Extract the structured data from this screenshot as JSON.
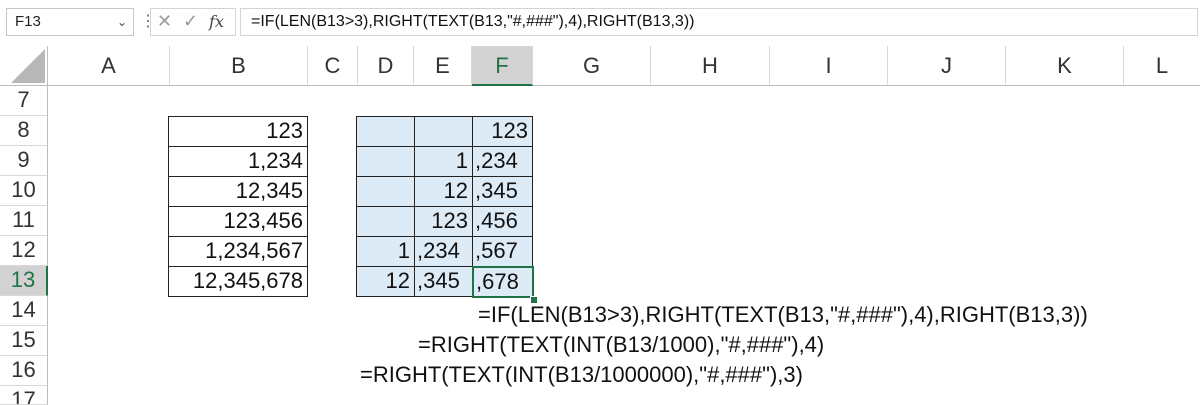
{
  "formula_bar": {
    "name_box": "F13",
    "cancel_glyph": "✕",
    "enter_glyph": "✓",
    "fx_label": "fx",
    "formula": "=IF(LEN(B13>3),RIGHT(TEXT(B13,\"#,###\"),4),RIGHT(B13,3))"
  },
  "columns": [
    "A",
    "B",
    "C",
    "D",
    "E",
    "F",
    "G",
    "H",
    "I",
    "J",
    "K",
    "L"
  ],
  "rows": [
    "7",
    "8",
    "9",
    "10",
    "11",
    "12",
    "13",
    "14",
    "15",
    "16",
    "17"
  ],
  "selected": {
    "cell": "F13",
    "column": "F",
    "row": "13"
  },
  "table_b": [
    "123",
    "1,234",
    "12,345",
    "123,456",
    "1,234,567",
    "12,345,678"
  ],
  "table_def": [
    [
      "",
      "",
      "123"
    ],
    [
      "",
      "1",
      ",234"
    ],
    [
      "",
      "12",
      ",345"
    ],
    [
      "",
      "123",
      ",456"
    ],
    [
      "1",
      ",234",
      ",567"
    ],
    [
      "12",
      ",345",
      ",678"
    ]
  ],
  "notes": [
    "=IF(LEN(B13>3),RIGHT(TEXT(B13,\"#,###\"),4),RIGHT(B13,3))",
    "=RIGHT(TEXT(INT(B13/1000),\"#,###\"),4)",
    "=RIGHT(TEXT(INT(B13/1000000),\"#,###\"),3)"
  ]
}
